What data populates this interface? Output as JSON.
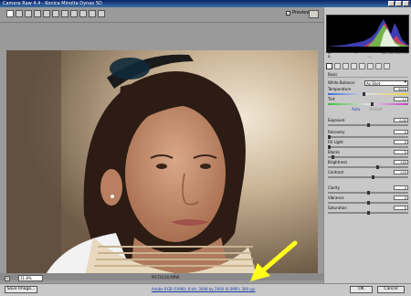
{
  "window": {
    "title": "Camera Raw 4.4  -  Konica Minolta Dynax 5D"
  },
  "toolbar": {
    "tools": [
      "zoom-icon",
      "hand-icon",
      "white-balance-icon",
      "color-sampler-icon",
      "crop-icon",
      "straighten-icon",
      "retouch-icon",
      "red-eye-icon",
      "preferences-icon",
      "rotate-left-icon",
      "rotate-right-icon"
    ],
    "preview_label": "Preview",
    "preview_checked": true
  },
  "histogram": {
    "readout": [
      {
        "left": "R:",
        "mid": "---",
        "right": "f/4  1/250 s"
      },
      {
        "left": "G:",
        "mid": "---",
        "right": "ISO 100  200 mm"
      },
      {
        "left": "B:",
        "mid": "---",
        "right": ""
      }
    ]
  },
  "panel": {
    "section_title": "Basic",
    "white_balance_label": "White Balance:",
    "white_balance_value": "As Shot",
    "auto_label": "Auto",
    "default_label": "Default",
    "sliders": [
      {
        "label": "Temperature",
        "value": "5050",
        "level": 0.45
      },
      {
        "label": "Tint",
        "value": "+7",
        "level": 0.55
      },
      {
        "label": "Exposure",
        "value": "0.00",
        "level": 0.5
      },
      {
        "label": "Recovery",
        "value": "0",
        "level": 0.0
      },
      {
        "label": "Fill Light",
        "value": "0",
        "level": 0.0
      },
      {
        "label": "Blacks",
        "value": "5",
        "level": 0.05
      },
      {
        "label": "Brightness",
        "value": "+50",
        "level": 0.62
      },
      {
        "label": "Contrast",
        "value": "+25",
        "level": 0.56
      },
      {
        "label": "Clarity",
        "value": "0",
        "level": 0.5
      },
      {
        "label": "Vibrance",
        "value": "0",
        "level": 0.5
      },
      {
        "label": "Saturation",
        "value": "0",
        "level": 0.5
      }
    ]
  },
  "canvas": {
    "zoom_minus": "-",
    "zoom_value": "31.8%",
    "filename": "PICT0126.MRW"
  },
  "footer": {
    "save_label": "Save Image...",
    "workflow_link": "Adobe RGB (1998); 8 bit; 3008 by 2000 (6.0MP); 300 ppi",
    "ok_label": "OK",
    "cancel_label": "Cancel"
  },
  "colors": {
    "arrow": "#ffff1a",
    "link": "#1a3fa8"
  }
}
